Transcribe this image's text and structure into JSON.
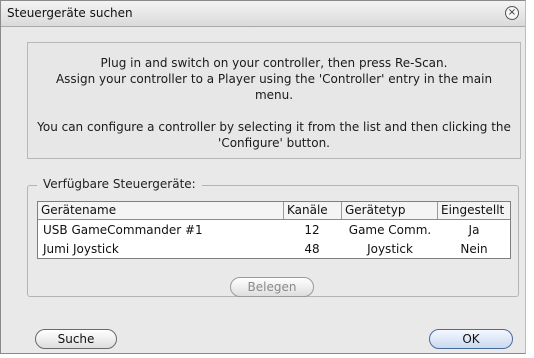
{
  "window": {
    "title": "Steuergeräte suchen",
    "close_glyph": "×"
  },
  "info": {
    "line1": "Plug in and switch on your controller, then press Re-Scan.",
    "line2": "Assign your controller to a Player using the 'Controller' entry in the main menu.",
    "line3": "You can configure a controller by selecting it from the list and then clicking the 'Configure' button."
  },
  "group": {
    "legend": "Verfügbare Steuergeräte:"
  },
  "table": {
    "columns": [
      "Gerätename",
      "Kanäle",
      "Gerätetyp",
      "Eingestellt"
    ],
    "rows": [
      {
        "name": "USB GameCommander #1",
        "channels": "12",
        "type": "Game Comm.",
        "configured": "Ja"
      },
      {
        "name": "Jumi Joystick",
        "channels": "48",
        "type": "Joystick",
        "configured": "Nein"
      }
    ]
  },
  "buttons": {
    "assign": "Belegen",
    "search": "Suche",
    "ok": "OK"
  },
  "icons": {
    "close": "close-icon"
  }
}
